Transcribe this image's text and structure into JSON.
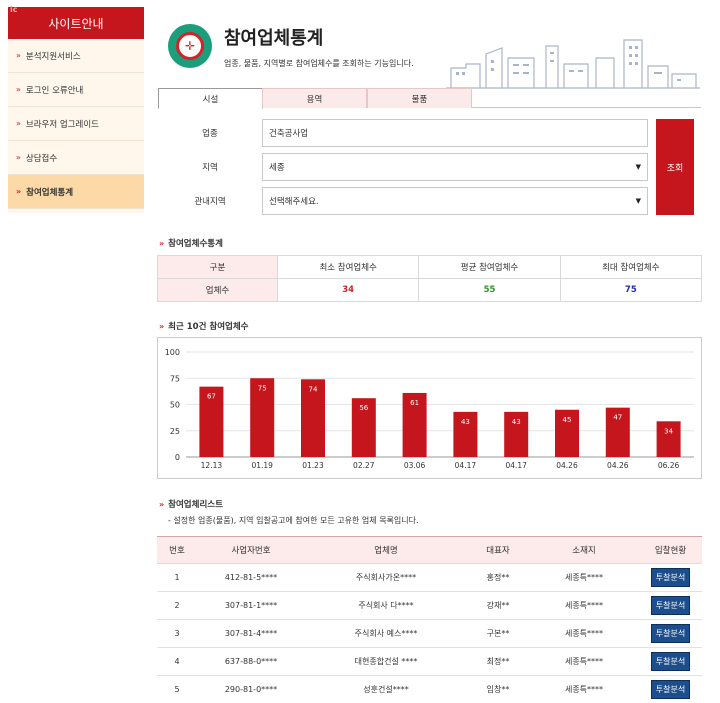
{
  "sidebar": {
    "logo": "ic",
    "title": "사이트안내",
    "bullet": "»",
    "items": [
      {
        "label": "분석지원서비스",
        "active": false
      },
      {
        "label": "로그인 오류안내",
        "active": false
      },
      {
        "label": "브라우저 업그레이드",
        "active": false
      },
      {
        "label": "상담접수",
        "active": false
      },
      {
        "label": "참여업체통계",
        "active": true
      }
    ]
  },
  "header": {
    "title": "참여업체통계",
    "description": "업종, 물품, 지역별로 참여업체수를 조회하는 기능입니다.",
    "icon": "target-icon"
  },
  "tabs": [
    {
      "label": "시설",
      "active": true
    },
    {
      "label": "용역",
      "active": false
    },
    {
      "label": "물품",
      "active": false
    }
  ],
  "form": {
    "industry_label": "업종",
    "industry_value": "건축공사업",
    "region_label": "지역",
    "region_value": "세종",
    "subregion_label": "관내지역",
    "subregion_value": "선택해주세요.",
    "search_label": "조회"
  },
  "stats": {
    "title": "참여업체수통계",
    "headers": [
      "구분",
      "최소 참여업체수",
      "평균 참여업체수",
      "최대 참여업체수"
    ],
    "row_label": "업체수",
    "min": "34",
    "avg": "55",
    "max": "75",
    "colors": {
      "min": "#d0202a",
      "avg": "#2a9a2a",
      "max": "#2030b0"
    }
  },
  "chart_section_title": "최근 10건 참여업체수",
  "chart_data": {
    "type": "bar",
    "categories": [
      "12.13",
      "01.19",
      "01.23",
      "02.27",
      "03.06",
      "04.17",
      "04.17",
      "04.26",
      "04.26",
      "06.26"
    ],
    "values": [
      67,
      75,
      74,
      56,
      61,
      43,
      43,
      45,
      47,
      34
    ],
    "ylim": [
      0,
      100
    ],
    "yticks": [
      0,
      25,
      50,
      75,
      100
    ],
    "bar_color": "#c4161c",
    "grid": true
  },
  "list": {
    "title": "참여업체리스트",
    "description": "- 설정한 업종(물품), 지역 입찰공고에 참여한 모든 고유한 업체 목록입니다.",
    "headers": [
      "번호",
      "사업자번호",
      "업체명",
      "대표자",
      "소재지",
      "입찰현황"
    ],
    "button_label": "투찰분석",
    "rows": [
      {
        "no": "1",
        "bizno": "412-81-5****",
        "name": "주식회사가온****",
        "ceo": "홍정**",
        "loc": "세종특****"
      },
      {
        "no": "2",
        "bizno": "307-81-1****",
        "name": "주식회사 다****",
        "ceo": "강재**",
        "loc": "세종특****"
      },
      {
        "no": "3",
        "bizno": "307-81-4****",
        "name": "주식회사 예스****",
        "ceo": "구본**",
        "loc": "세종특****"
      },
      {
        "no": "4",
        "bizno": "637-88-0****",
        "name": "대현종합건설 ****",
        "ceo": "최정**",
        "loc": "세종특****"
      },
      {
        "no": "5",
        "bizno": "290-81-0****",
        "name": "성훈건설****",
        "ceo": "임창**",
        "loc": "세종특****"
      }
    ]
  }
}
